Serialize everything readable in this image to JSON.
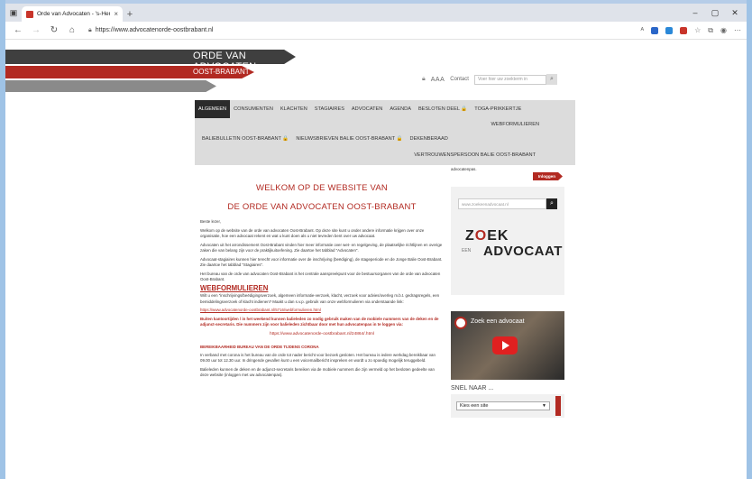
{
  "browser": {
    "tab_title": "Orde van Advocaten - 's-Hertog",
    "tab_close": "×",
    "new_tab": "+",
    "url": "https://www.advocatenorde-oostbrabant.nl",
    "min": "–",
    "max": "▢",
    "close": "✕"
  },
  "header": {
    "band_dark": "ORDE VAN ADVOCATEN",
    "band_red": "OOST-BRABANT",
    "aaa": "AAA",
    "contact": "Contact",
    "search_placeholder": "Voer hier uw zoekterm in"
  },
  "nav": {
    "row1": [
      "ALGEMEEN",
      "CONSUMENTEN",
      "KLACHTEN",
      "STAGIAIRES",
      "ADVOCATEN",
      "AGENDA",
      "BESLOTEN DEEL 🔒",
      "TOGA-PRIKKERTJE"
    ],
    "row1b": "WEBFORMULIEREN",
    "row2": [
      "BALIEBULLETIN OOST-BRABANT 🔒",
      "NIEUWSBRIEVEN BALIE OOST-BRABANT 🔒",
      "DEKENBERAAD"
    ],
    "row3": "VERTROUWENSPERSOON BALIE OOST-BRABANT"
  },
  "content": {
    "welcome1": "WELKOM OP DE WEBSITE VAN",
    "welcome2": "DE ORDE VAN ADVOCATEN OOST-BRABANT",
    "greeting": "Beste lezer,",
    "p1": "Welkom op de website van de orde van advocaten Oost-Brabant. Op deze site kunt u onder andere informatie krijgen over onze organisatie, hoe een advocaat rekent en wat u kunt doen als u niet tevreden bent over uw advocaat.",
    "p2": "Advocaten uit het arrondissement Oost-Brabant vinden hier meer informatie over wet- en regelgeving, de plaatselijke richtlijnen en overige zaken die van belang zijn voor de praktijkuitoefening. Zie daartoe het tabblad \"Advocaten\".",
    "p3": "Advocaat-stagiaires kunnen hier terecht voor informatie over de inschrijving (beëdiging), de stageperiode en de Jonge Balie Oost-Brabant. Zie daartoe het tabblad \"Stagiaires\".",
    "p4": "Het bureau van de orde van advocaten Oost-Brabant is het centrale aanspreekpunt voor de bestuursorganen van de orde van advocaten Oost-Brabant.",
    "webform_heading": "WEBFORMULIEREN",
    "p5": "Wilt u een \"inschrijvings/beëdigingsverzoek, algemeen informatie-verzoek, klacht, verzoek voor advies/overleg m.b.t. gedragsregels, een bemiddelingsverzoek of klacht indienen? Maakt u dan s.v.p. gebruik van onze webformulieren via onderstaande link:",
    "link1": "https://www.advocatenorde-oostbrabant.nl/5716/webformulieren.html",
    "bold_red": "Buiten kantoortijden / in het weekend kunnen balieleden zo nodig gebruik maken van de mobiele nummers van de deken en de adjunct-secretaris. Die nummers zijn voor balieleden zichtbaar door met hun advocatenpas in te loggen via:",
    "link2": "https://www.advocatenorde-oostbrabant.nl/24864/.html",
    "corona_heading": "BEREIKBAARHEID BUREAU VAN DE ORDE TIJDENS CORONA",
    "p6": "In verband met corona is het bureau van de orde tot nader bericht voor bezoek gesloten. Het bureau is iedere werkdag bereikbaar van 09.00 uur tot 12.30 uur. In dringende gevallen kunt u een voicemailbericht inspreken en wordt u zo spoedig mogelijk teruggebeld.",
    "p7": "Balieleden kunnen de deken en de adjunct-secretaris bereiken via de mobiele nummers die zijn vermeld op het besloten gedeelte van deze website (inloggen met uw advocatenpas)."
  },
  "sidebar": {
    "caption": "advocatenpas.",
    "login": "Inloggen",
    "zoek_input": "www.zoekeenadvocaat.nl",
    "zoek_word": "ZOEK",
    "zoek_een": "EEN",
    "advocaat_word": "ADVOCAAT",
    "video_title": "Zoek een advocaat",
    "snel_label": "SNEL NAAR ...",
    "select_value": "Kies een site"
  }
}
